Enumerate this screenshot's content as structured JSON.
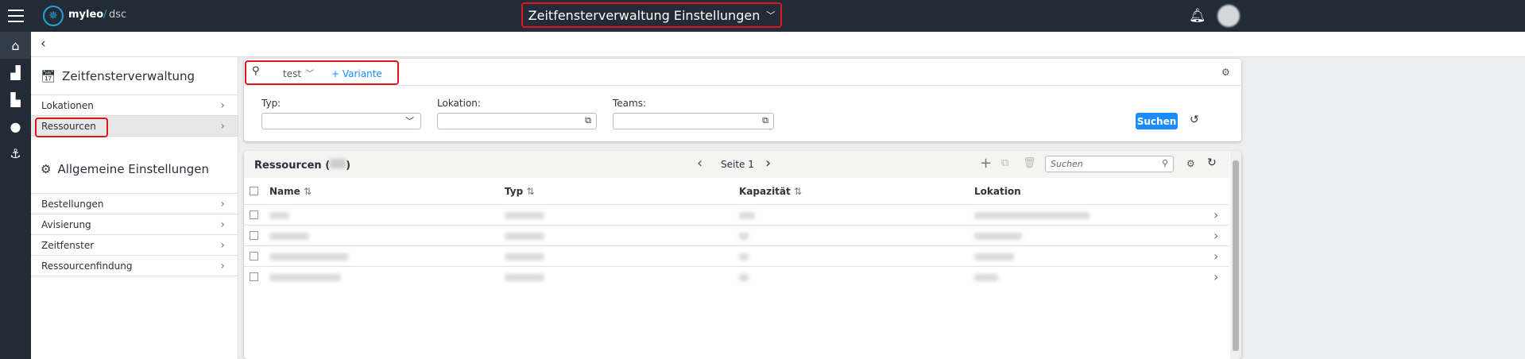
{
  "header": {
    "brand": "myleo",
    "brand_suffix": "dsc",
    "title": "Zeitfensterverwaltung Einstellungen"
  },
  "left": {
    "section1": "Zeitfensterverwaltung",
    "items1": [
      "Lokationen",
      "Ressourcen"
    ],
    "section2": "Allgemeine Einstellungen",
    "items2": [
      "Bestellungen",
      "Avisierung",
      "Zeitfenster",
      "Ressourcenfindung"
    ]
  },
  "filter": {
    "variant": "test",
    "add_variant": "+ Variante",
    "typ_label": "Typ:",
    "lokation_label": "Lokation:",
    "teams_label": "Teams:",
    "search_button": "Suchen"
  },
  "table": {
    "title": "Ressourcen (",
    "title_end": ")",
    "page": "Seite 1",
    "search_placeholder": "Suchen",
    "columns": [
      "Name",
      "Typ",
      "Kapazität",
      "Lokation"
    ]
  },
  "colors": {
    "accent": "#1a8cff",
    "topbar": "#232b36"
  }
}
